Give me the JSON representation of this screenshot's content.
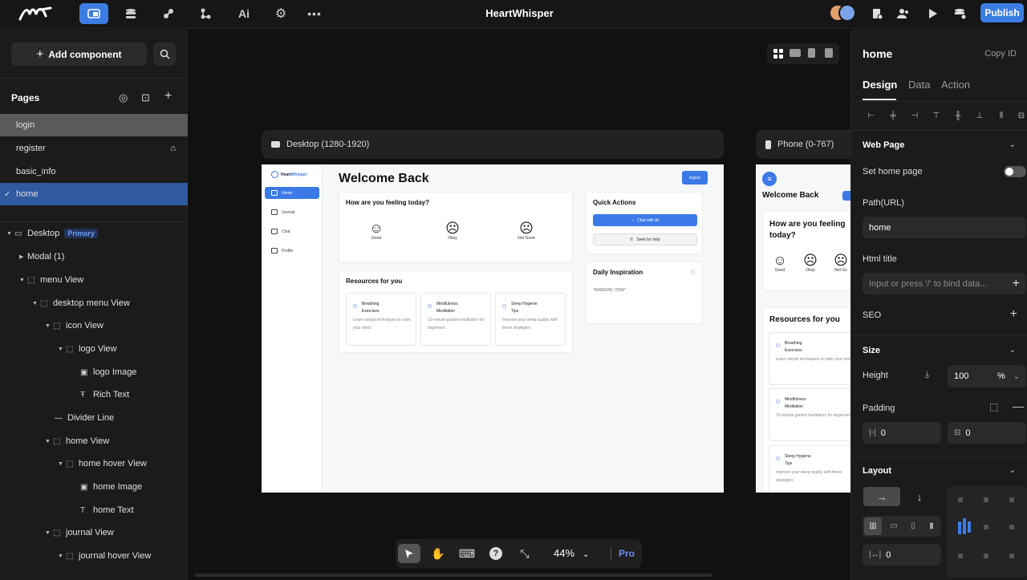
{
  "topbar": {
    "app_title": "HeartWhisper",
    "publish": "Publish"
  },
  "left": {
    "add_component": "Add component",
    "pages_heading": "Pages",
    "pages": [
      "login",
      "register",
      "basic_info",
      "home"
    ],
    "tree": [
      {
        "label": "Desktop",
        "badge": "Primary"
      },
      {
        "label": "Modal (1)"
      },
      {
        "label": "menu View"
      },
      {
        "label": "desktop menu View"
      },
      {
        "label": "icon View"
      },
      {
        "label": "logo View"
      },
      {
        "label": "logo Image"
      },
      {
        "label": "Rich Text"
      },
      {
        "label": "Divider Line"
      },
      {
        "label": "home View"
      },
      {
        "label": "home hover View"
      },
      {
        "label": "home Image"
      },
      {
        "label": "home Text"
      },
      {
        "label": "journal View"
      },
      {
        "label": "journal hover View"
      }
    ]
  },
  "canvas": {
    "desktop_tab": "Desktop (1280-1920)",
    "phone_tab": "Phone (0-767)",
    "zoom": "44%",
    "pro": "Pro",
    "preview": {
      "brand_a": "Heart",
      "brand_b": "Whisper",
      "nav": [
        "Home",
        "Journal",
        "Chat",
        "Profile"
      ],
      "welcome": "Welcome Back",
      "logout": "logout",
      "feeling": "How are you feeling today?",
      "moods": [
        "Good",
        "Okay",
        "Not Good"
      ],
      "quick_actions": "Quick Actions",
      "chat_ai": "Chat with AI",
      "seek_help": "Seek for help",
      "daily": "Daily Inspiration",
      "random": "\"RANDOM_ITEM\"",
      "resources": "Resources for you",
      "res1_title_a": "Breathing",
      "res1_title_b": "Exercises",
      "res1_desc": "Learn simple techniques to calm your mind",
      "res2_title_a": "Mindfulness",
      "res2_title_b": "Meditation",
      "res2_desc": "10-minute guided meditation for beginners",
      "res3_title_a": "Sleep Hygiene",
      "res3_title_b": "Tips",
      "res3_desc": "Improve your sleep quality with these strategies",
      "phone_feeling": "How are you feeling today?",
      "phone_moods": [
        "Good",
        "Okay",
        "Not Go"
      ]
    }
  },
  "right": {
    "title": "home",
    "copy_id": "Copy ID",
    "tabs": [
      "Design",
      "Data",
      "Action"
    ],
    "web_page": "Web Page",
    "set_home": "Set home page",
    "path_label": "Path(URL)",
    "path_value": "home",
    "html_title": "Html title",
    "html_title_ph": "Input or press '/' to bind data...",
    "seo": "SEO",
    "size": "Size",
    "height": "Height",
    "height_value": "100",
    "height_unit": "%",
    "padding": "Padding",
    "pad_a": "0",
    "pad_b": "0",
    "layout": "Layout",
    "gap": "0"
  }
}
